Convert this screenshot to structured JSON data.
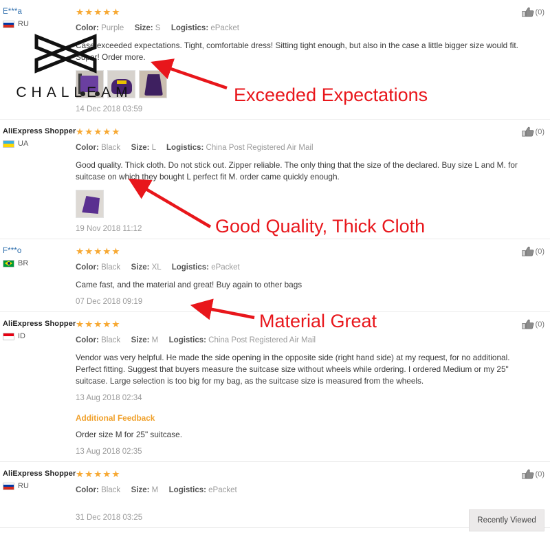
{
  "watermark": {
    "brand": "CHALLEAM"
  },
  "like_label": "(0)",
  "recently_viewed": {
    "label": "Recently Viewed"
  },
  "labels": {
    "color": "Color:",
    "size": "Size:",
    "logistics": "Logistics:",
    "additional_feedback": "Additional Feedback"
  },
  "stars_glyph": "★★★★★",
  "reviews": [
    {
      "reviewer": "E***a",
      "country": "RU",
      "rating": 5,
      "color": "Purple",
      "size": "S",
      "logistics": "ePacket",
      "text": "Case exceeded expectations. Tight, comfortable dress! Sitting tight enough, but also in the case a little bigger size would fit. Super! Order more.",
      "timestamp": "14 Dec 2018 03:59",
      "likes": "(0)",
      "photos": 3
    },
    {
      "reviewer": "AliExpress Shopper",
      "country": "UA",
      "rating": 5,
      "color": "Black",
      "size": "L",
      "logistics": "China Post Registered Air Mail",
      "text": "Good quality. Thick cloth. Do not stick out. Zipper reliable. The only thing that the size of the declared. Buy size L and M. for suitcase on which they bought L perfect fit M. order came quickly enough.",
      "timestamp": "19 Nov 2018 11:12",
      "likes": "(0)",
      "photos": 1
    },
    {
      "reviewer": "F***o",
      "country": "BR",
      "rating": 5,
      "color": "Black",
      "size": "XL",
      "logistics": "ePacket",
      "text": "Came fast, and the material and great! Buy again to other bags",
      "timestamp": "07 Dec 2018 09:19",
      "likes": "(0)",
      "photos": 0
    },
    {
      "reviewer": "AliExpress Shopper",
      "country": "ID",
      "rating": 5,
      "color": "Black",
      "size": "M",
      "logistics": "China Post Registered Air Mail",
      "text": "Vendor was very helpful. He made the side opening in the opposite side (right hand side) at my request, for no additional. Perfect fitting. Suggest that buyers measure the suitcase size without wheels while ordering. I ordered Medium or my 25\" suitcase. Large selection is too big for my bag, as the suitcase size is measured from the wheels.",
      "timestamp": "13 Aug 2018 02:34",
      "likes": "(0)",
      "photos": 0,
      "additional_feedback": {
        "title": "Additional Feedback",
        "text": "Order size M for 25\" suitcase.",
        "timestamp": "13 Aug 2018 02:35"
      }
    },
    {
      "reviewer": "AliExpress Shopper",
      "country": "RU",
      "rating": 5,
      "color": "Black",
      "size": "M",
      "logistics": "ePacket",
      "text": "",
      "timestamp": "31 Dec 2018 03:25",
      "likes": "(0)",
      "photos": 0
    }
  ],
  "annotations": [
    {
      "text": "Exceeded Expectations",
      "color": "#e8161b"
    },
    {
      "text": "Good Quality, Thick Cloth",
      "color": "#e8161b"
    },
    {
      "text": "Material Great",
      "color": "#e8161b"
    }
  ]
}
